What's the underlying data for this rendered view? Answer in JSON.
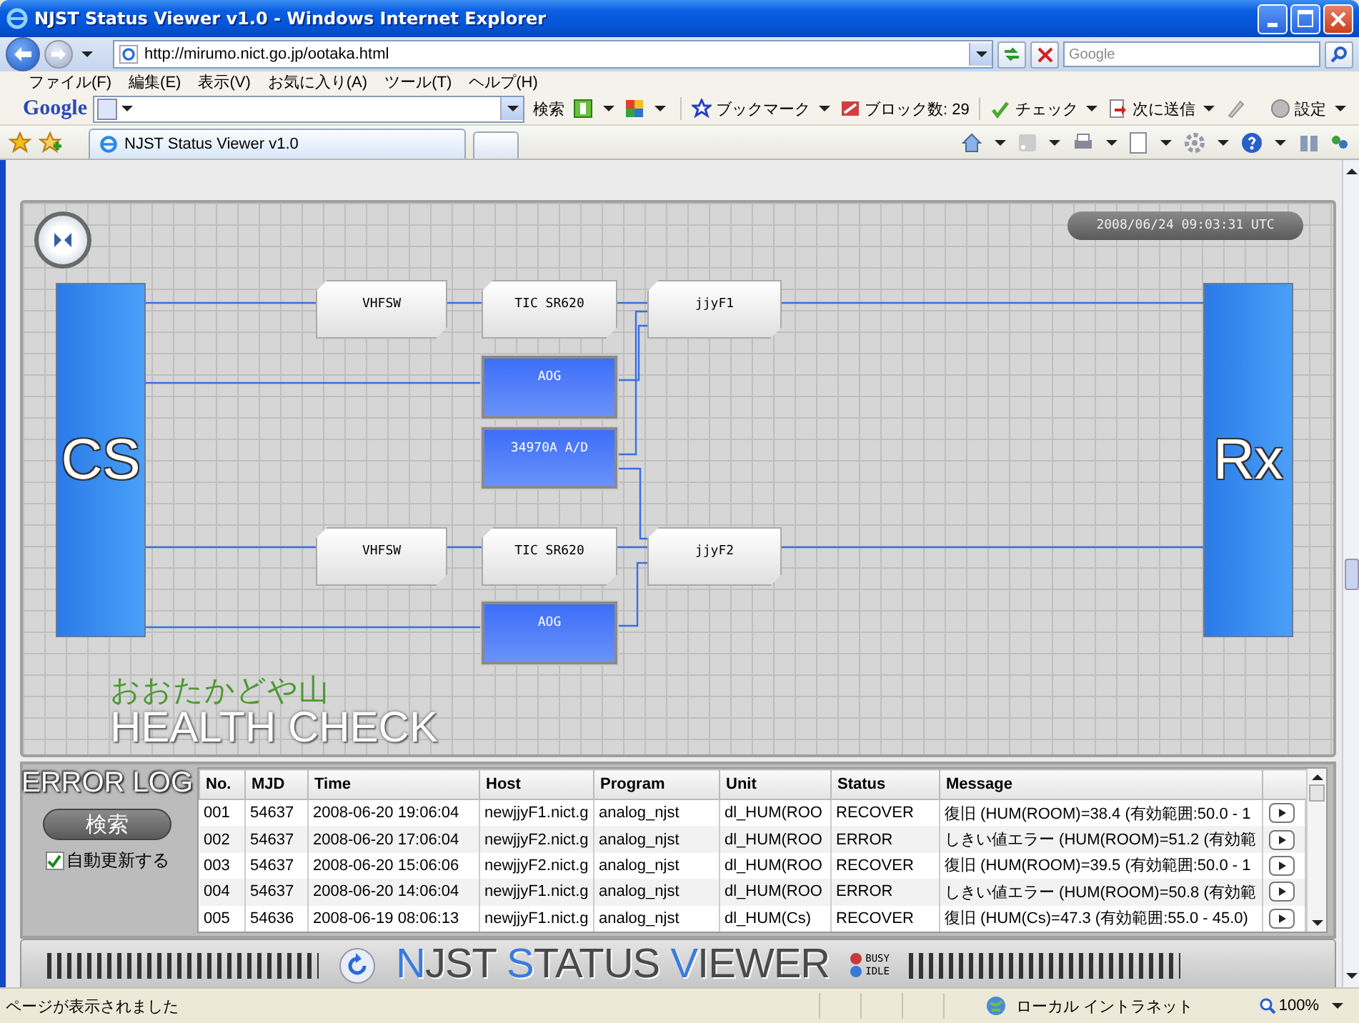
{
  "window": {
    "title": "NJST Status Viewer v1.0 - Windows Internet Explorer"
  },
  "address_bar": {
    "url": "http://mirumo.nict.go.jp/ootaka.html",
    "search_placeholder": "Google"
  },
  "menu": [
    "ファイル(F)",
    "編集(E)",
    "表示(V)",
    "お気に入り(A)",
    "ツール(T)",
    "ヘルプ(H)"
  ],
  "google_toolbar": {
    "logo": "Google",
    "search_button": "検索",
    "items": [
      {
        "label": "ブックマーク",
        "dropdown": true
      },
      {
        "label": "ブロック数: 29",
        "dropdown": false
      },
      {
        "label": "チェック",
        "dropdown": true
      },
      {
        "label": "次に送信",
        "dropdown": true
      }
    ],
    "settings": {
      "label": "設定",
      "dropdown": true
    }
  },
  "tabs": [
    {
      "label": "NJST Status Viewer v1.0",
      "selected": true
    }
  ],
  "diagram": {
    "clock": "2008/06/24 09:03:31 UTC",
    "nodes": [
      {
        "label": "CS",
        "kind": "endpoint"
      },
      {
        "label": "Rx",
        "kind": "endpoint"
      },
      {
        "label": "VHFSW",
        "kind": "device"
      },
      {
        "label": "TIC SR620",
        "kind": "device"
      },
      {
        "label": "jjyF1",
        "kind": "device"
      },
      {
        "label": "AOG",
        "kind": "active"
      },
      {
        "label": "34970A A/D",
        "kind": "active"
      },
      {
        "label": "VHFSW",
        "kind": "device"
      },
      {
        "label": "TIC SR620",
        "kind": "device"
      },
      {
        "label": "jjyF2",
        "kind": "device"
      },
      {
        "label": "AOG",
        "kind": "active"
      }
    ],
    "site_name": "おおたかどや山",
    "caption": "HEALTH CHECK"
  },
  "error_log": {
    "title": "ERROR LOG",
    "search_button": "検索",
    "auto_update": {
      "label": "自動更新する",
      "checked": true
    },
    "columns": [
      "No.",
      "MJD",
      "Time",
      "Host",
      "Program",
      "Unit",
      "Status",
      "Message"
    ],
    "rows": [
      [
        "001",
        "54637",
        "2008-06-20 19:06:04",
        "newjjyF1.nict.g",
        "analog_njst",
        "dl_HUM(ROO",
        "RECOVER",
        "復旧 (HUM(ROOM)=38.4 (有効範囲:50.0 - 1"
      ],
      [
        "002",
        "54637",
        "2008-06-20 17:06:04",
        "newjjyF2.nict.g",
        "analog_njst",
        "dl_HUM(ROO",
        "ERROR",
        "しきい値エラー (HUM(ROOM)=51.2 (有効範"
      ],
      [
        "003",
        "54637",
        "2008-06-20 15:06:06",
        "newjjyF2.nict.g",
        "analog_njst",
        "dl_HUM(ROO",
        "RECOVER",
        "復旧 (HUM(ROOM)=39.5 (有効範囲:50.0 - 1"
      ],
      [
        "004",
        "54637",
        "2008-06-20 14:06:04",
        "newjjyF1.nict.g",
        "analog_njst",
        "dl_HUM(ROO",
        "ERROR",
        "しきい値エラー (HUM(ROOM)=50.8 (有効範"
      ],
      [
        "005",
        "54636",
        "2008-06-19 08:06:13",
        "newjjyF1.nict.g",
        "analog_njst",
        "dl_HUM(Cs)",
        "RECOVER",
        "復旧 (HUM(Cs)=47.3 (有効範囲:55.0 - 45.0)"
      ]
    ]
  },
  "footer": {
    "logo": "NJST STATUS VIEWER",
    "indicators": [
      {
        "label": "BUSY",
        "color": "#c83a3a"
      },
      {
        "label": "IDLE",
        "color": "#3a78d8"
      }
    ]
  },
  "status_bar": {
    "message": "ページが表示されました",
    "zone": "ローカル イントラネット",
    "zoom": "100%"
  }
}
